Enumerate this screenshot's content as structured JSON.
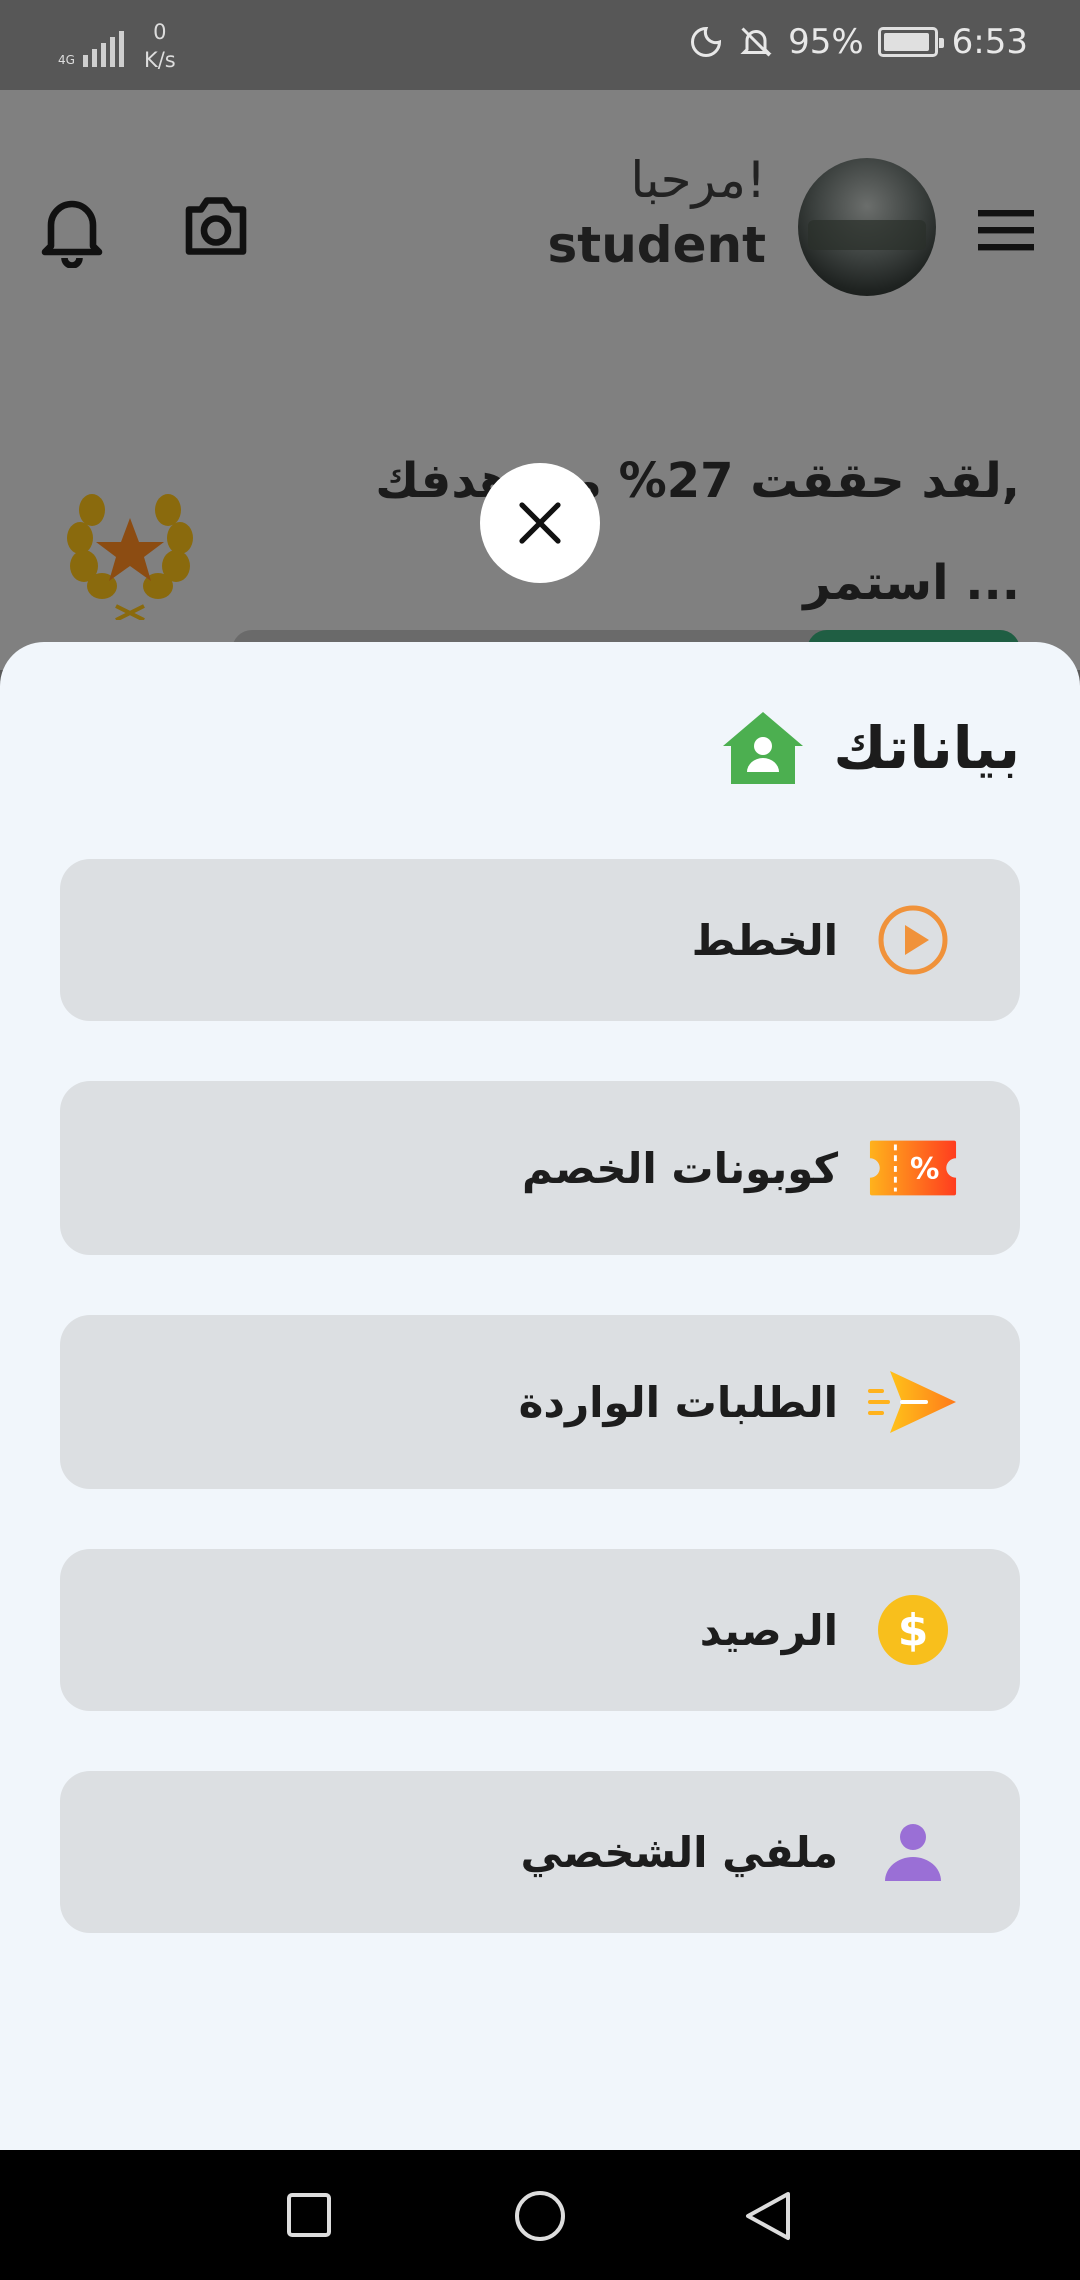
{
  "status_bar": {
    "network": "4G",
    "speed_value": "0",
    "speed_unit": "K/s",
    "battery": "95%",
    "time": "6:53"
  },
  "header": {
    "greeting": "مرحبا!",
    "username": "student",
    "icons": [
      "menu-icon",
      "camera-icon",
      "bell-icon"
    ]
  },
  "progress": {
    "line1": "لقد حققت 27% من هدفك,",
    "line2": "استمر ...",
    "percent": 27,
    "icon": "laurel-star-icon"
  },
  "sheet": {
    "title": "بياناتك",
    "title_icon": "home-user-icon",
    "items": [
      {
        "label": "الخطط",
        "icon": "play-circle-icon",
        "color": "#f0923a"
      },
      {
        "label": "كوبونات الخصم",
        "icon": "coupon-percent-icon",
        "color": "#ff6a1a"
      },
      {
        "label": "الطلبات الواردة",
        "icon": "paper-plane-icon",
        "color": "#ff9a1f"
      },
      {
        "label": "الرصيد",
        "icon": "dollar-coin-icon",
        "color": "#f8bf1c"
      },
      {
        "label": "ملفي الشخصي",
        "icon": "user-icon",
        "color": "#9a6fd6"
      }
    ]
  },
  "colors": {
    "sheet_bg": "#f1f6fb",
    "item_bg": "#dcdfe2",
    "home_icon": "#4caf50",
    "progress_fill": "#1f5e43"
  },
  "nav": [
    "recent-apps-button",
    "home-button",
    "back-button"
  ]
}
